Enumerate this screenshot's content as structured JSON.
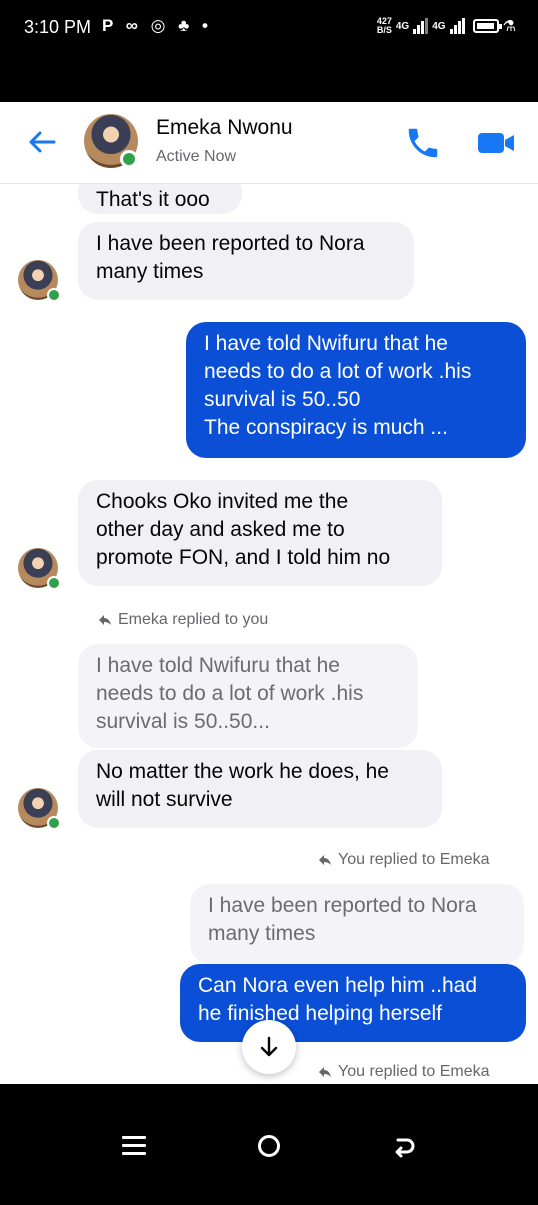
{
  "status_bar": {
    "time": "3:10 PM",
    "left_icons": "P ∞ ◎ ♣ •",
    "speed_value": "427",
    "speed_unit": "B/S",
    "network_1": "4G",
    "network_2": "4G"
  },
  "header": {
    "contact_name": "Emeka Nwonu",
    "contact_status": "Active Now",
    "accent_color": "#1877f2"
  },
  "messages": [
    {
      "text": "That's it ooo"
    },
    {
      "text": "I have been reported to Nora\nmany times"
    },
    {
      "text": "I have told Nwifuru that he\nneeds to do a lot of work .his\nsurvival is 50..50\nThe conspiracy is much ..."
    },
    {
      "text": "Chooks Oko invited me the\nother day and asked me to\npromote FON, and I told him no"
    },
    {
      "text": "Emeka replied to you"
    },
    {
      "text": "I have told Nwifuru that he\nneeds to do a lot of work .his\nsurvival is 50..50..."
    },
    {
      "text": "No matter the work he does, he\nwill not survive"
    },
    {
      "text": "You replied to Emeka"
    },
    {
      "text": "I have been reported to Nora\nmany times"
    },
    {
      "text": "Can Nora even help him ..had\nhe finished helping herself"
    },
    {
      "text": "You replied to Emeka"
    }
  ],
  "colors": {
    "outgoing_bubble": "#0a4fd6",
    "incoming_bubble": "#f0f0f5",
    "online_dot": "#31a24c"
  }
}
